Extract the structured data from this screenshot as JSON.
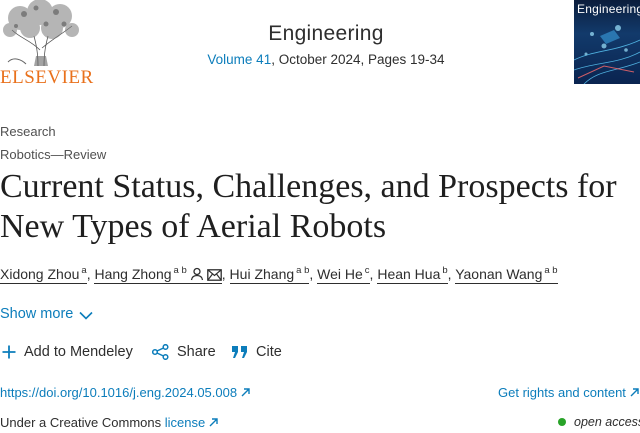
{
  "publisher": {
    "name": "ELSEVIER"
  },
  "journal": {
    "title": "Engineering",
    "volume_link": "Volume 41",
    "issue_rest": ", October 2024, Pages 19-34",
    "cover_title": "Engineering"
  },
  "article": {
    "type": "Research",
    "subtype": "Robotics—Review",
    "title": "Current Status, Challenges, and Prospects for New Types of Aerial Robots"
  },
  "authors": [
    {
      "name": "Xidong Zhou",
      "affil": "a",
      "sep": ", "
    },
    {
      "name": "Hang Zhong",
      "affil": "a b",
      "sep": ", "
    },
    {
      "name": "Hui Zhang",
      "affil": "a b",
      "sep": ", "
    },
    {
      "name": "Wei He",
      "affil": "c",
      "sep": ", "
    },
    {
      "name": "Hean Hua",
      "affil": "b",
      "sep": ", "
    },
    {
      "name": "Yaonan Wang",
      "affil": "a b",
      "sep": ""
    }
  ],
  "show_more": "Show more",
  "actions": {
    "mendeley": "Add to Mendeley",
    "share": "Share",
    "cite": "Cite"
  },
  "links": {
    "doi": "https://doi.org/10.1016/j.eng.2024.05.008",
    "rights": "Get rights and content",
    "license_prefix": "Under a Creative Commons ",
    "license_link": "license",
    "open_access": "open access"
  },
  "colors": {
    "link": "#0c7dbb",
    "elsevier_orange": "#e9711c",
    "open_access_green": "#29a329"
  }
}
